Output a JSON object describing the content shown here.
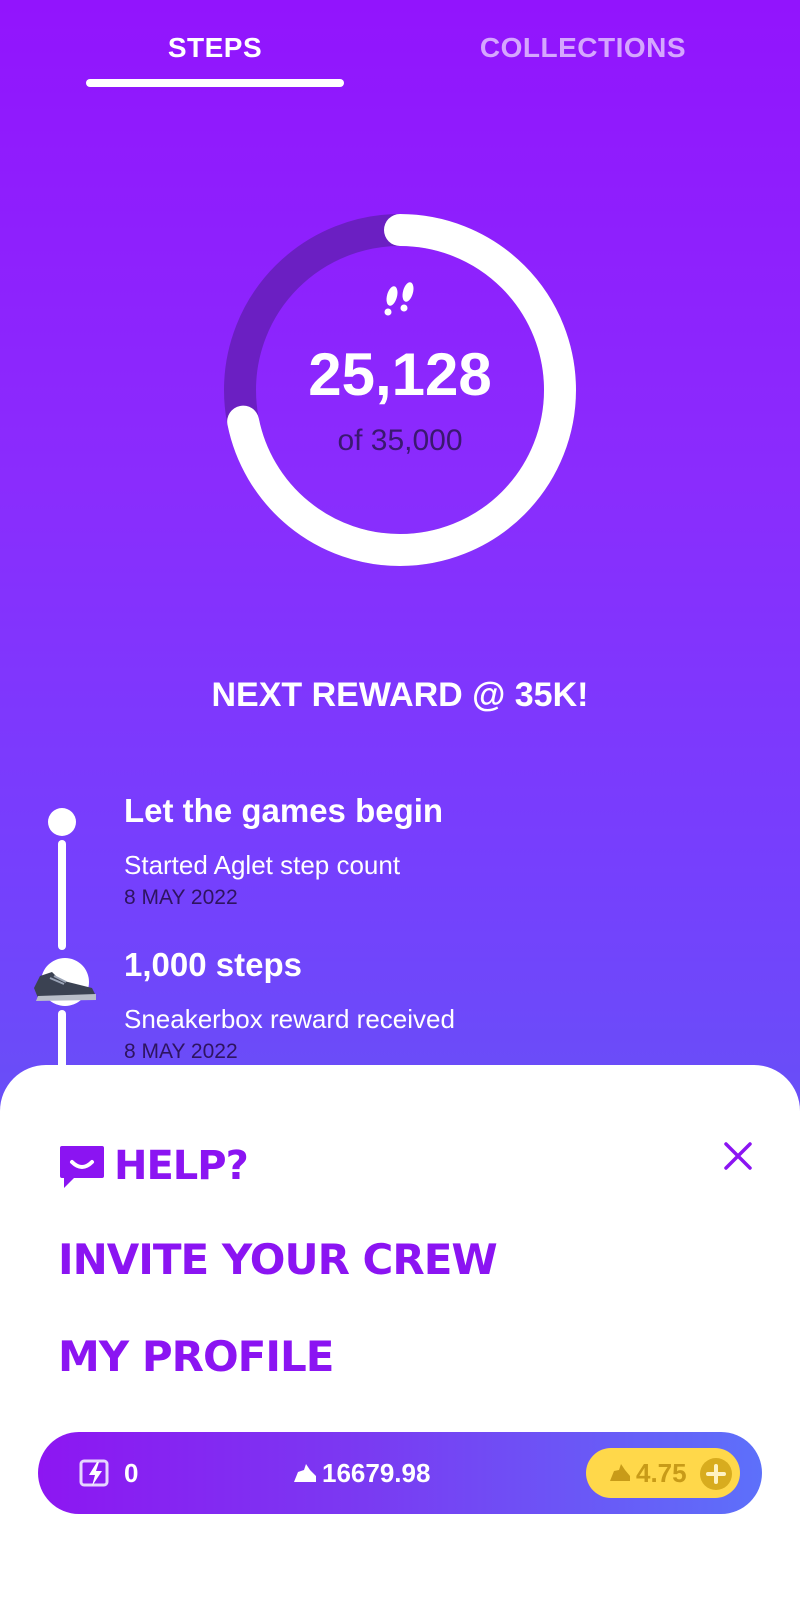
{
  "tabs": {
    "steps": "STEPS",
    "collections": "COLLECTIONS"
  },
  "progress": {
    "count": "25,128",
    "goal": "of 35,000",
    "fraction": 0.718
  },
  "next_reward": "NEXT REWARD @ 35K!",
  "timeline": [
    {
      "title": "Let the games begin",
      "subtitle": "Started Aglet step count",
      "date": "8 MAY 2022",
      "icon": "start-dot"
    },
    {
      "title": "1,000 steps",
      "subtitle": "Sneakerbox reward received",
      "date": "8 MAY 2022",
      "icon": "sneaker-icon"
    }
  ],
  "menu": {
    "help": "HELP?",
    "invite": "INVITE YOUR CREW",
    "profile": "MY PROFILE"
  },
  "wallet": {
    "energy": "0",
    "aglet_coins": "16679.98",
    "gold": "4.75"
  },
  "colors": {
    "accent": "#8b14f2",
    "gold": "#ffd84a",
    "background_top": "#9214fd"
  }
}
